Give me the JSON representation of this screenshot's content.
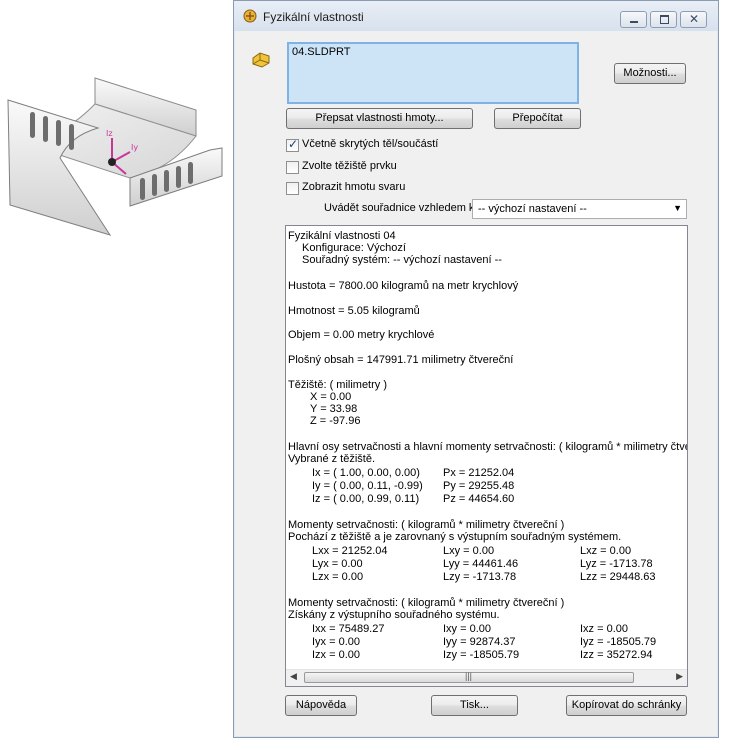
{
  "window": {
    "title": "Fyzikální vlastnosti"
  },
  "file": {
    "name": "04.SLDPRT"
  },
  "buttons": {
    "options": "Možnosti...",
    "override_mass": "Přepsat vlastnosti hmoty...",
    "recalculate": "Přepočítat",
    "help": "Nápověda",
    "print": "Tisk...",
    "copy": "Kopírovat do schránky"
  },
  "checkboxes": [
    {
      "label": "Včetně skrytých těl/součástí",
      "checked": true
    },
    {
      "label": "Zvolte těžiště prvku",
      "checked": false
    },
    {
      "label": "Zobrazit hmotu svaru",
      "checked": false
    }
  ],
  "coordinates": {
    "label": "Uvádět souřadnice vzhledem k:",
    "selected": "-- výchozí nastavení --"
  },
  "results": {
    "header": "Fyzikální vlastnosti 04",
    "configuration": "Konfigurace: Výchozí",
    "coord_system": "Souřadný systém: -- výchozí nastavení --",
    "density": "Hustota = 7800.00 kilogramů na  metr krychlový",
    "mass": "Hmotnost = 5.05 kilogramů",
    "volume": "Objem = 0.00 metry krychlové",
    "surface": "Plošný obsah = 147991.71  milimetry čtvereční",
    "cog_title": "Těžiště: ( milimetry )",
    "cog": [
      "X = 0.00",
      "Y = 33.98",
      "Z = -97.96"
    ],
    "principal_title": "Hlavní osy setrvačnosti a hlavní momenty setrvačnosti: ( kilogramů *  milimetry čtvereční )",
    "principal_sub": "Vybrané z těžiště.",
    "principal_rows": [
      {
        "axis": "Ix = ( 1.00,  0.00,  0.00)",
        "moment": "Px = 21252.04"
      },
      {
        "axis": "Iy = ( 0.00,  0.11, -0.99)",
        "moment": "Py = 29255.48"
      },
      {
        "axis": "Iz = ( 0.00,  0.99,  0.11)",
        "moment": "Pz = 44654.60"
      }
    ],
    "moments_cog_title": "Momenty setrvačnosti: ( kilogramů *  milimetry čtvereční )",
    "moments_cog_sub": "Pochází z těžiště a je zarovnaný s výstupním souřadným systémem.",
    "moments_cog_rows": [
      [
        "Lxx = 21252.04",
        "Lxy = 0.00",
        "Lxz = 0.00"
      ],
      [
        "Lyx = 0.00",
        "Lyy = 44461.46",
        "Lyz = -1713.78"
      ],
      [
        "Lzx = 0.00",
        "Lzy = -1713.78",
        "Lzz = 29448.63"
      ]
    ],
    "moments_out_title": "Momenty setrvačnosti: ( kilogramů *  milimetry čtvereční )",
    "moments_out_sub": "Získány z výstupního souřadného systému.",
    "moments_out_rows": [
      [
        "Ixx = 75489.27",
        "Ixy = 0.00",
        "Ixz = 0.00"
      ],
      [
        "Iyx = 0.00",
        "Iyy = 92874.37",
        "Iyz = -18505.79"
      ],
      [
        "Izx = 0.00",
        "Izy = -18505.79",
        "Izz = 35272.94"
      ]
    ]
  },
  "part_view": {
    "triad_labels": [
      "Iz",
      "Iy"
    ]
  },
  "colors": {
    "selection": "#cde4f7",
    "selection_border": "#7fb2e5",
    "triad": "#c8349a"
  }
}
